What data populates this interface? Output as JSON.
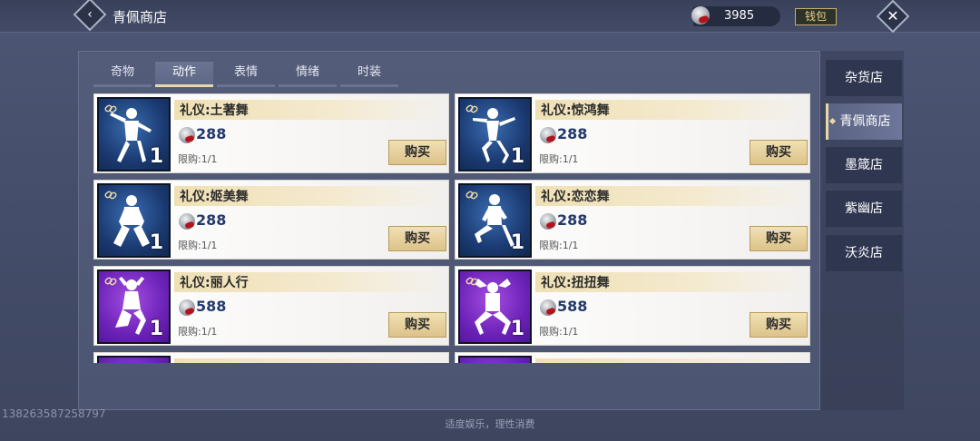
{
  "header": {
    "title": "青佩商店",
    "currency_amount": "3985",
    "wallet_label": "钱包",
    "back_icon": "chevron-left-icon",
    "close_icon": "close-icon"
  },
  "tabs": [
    {
      "label": "奇物",
      "active": false
    },
    {
      "label": "动作",
      "active": true
    },
    {
      "label": "表情",
      "active": false
    },
    {
      "label": "情绪",
      "active": false
    },
    {
      "label": "时装",
      "active": false
    }
  ],
  "items": [
    {
      "name": "礼仪:土著舞",
      "price": "288",
      "limit": "限购:1/1",
      "qty": "1",
      "rarity": "blue",
      "buy_label": "购买"
    },
    {
      "name": "礼仪:惊鸿舞",
      "price": "288",
      "limit": "限购:1/1",
      "qty": "1",
      "rarity": "blue",
      "buy_label": "购买"
    },
    {
      "name": "礼仪:姬美舞",
      "price": "288",
      "limit": "限购:1/1",
      "qty": "1",
      "rarity": "blue",
      "buy_label": "购买"
    },
    {
      "name": "礼仪:恋恋舞",
      "price": "288",
      "limit": "限购:1/1",
      "qty": "1",
      "rarity": "blue",
      "buy_label": "购买"
    },
    {
      "name": "礼仪:丽人行",
      "price": "588",
      "limit": "限购:1/1",
      "qty": "1",
      "rarity": "purple",
      "buy_label": "购买"
    },
    {
      "name": "礼仪:扭扭舞",
      "price": "588",
      "limit": "限购:1/1",
      "qty": "1",
      "rarity": "purple",
      "buy_label": "购买"
    }
  ],
  "sidebar": {
    "items": [
      {
        "label": "杂货店",
        "active": false
      },
      {
        "label": "青佩商店",
        "active": true
      },
      {
        "label": "墨箴店",
        "active": false
      },
      {
        "label": "紫幽店",
        "active": false
      },
      {
        "label": "沃炎店",
        "active": false
      }
    ]
  },
  "footer": {
    "note": "适度娱乐，理性消费",
    "watermark": "13826358725879​7"
  },
  "colors": {
    "accent_gold": "#e8d8a6",
    "rarity_blue": "#1b3a72",
    "rarity_purple": "#6d22b8",
    "price_text": "#23396b"
  }
}
